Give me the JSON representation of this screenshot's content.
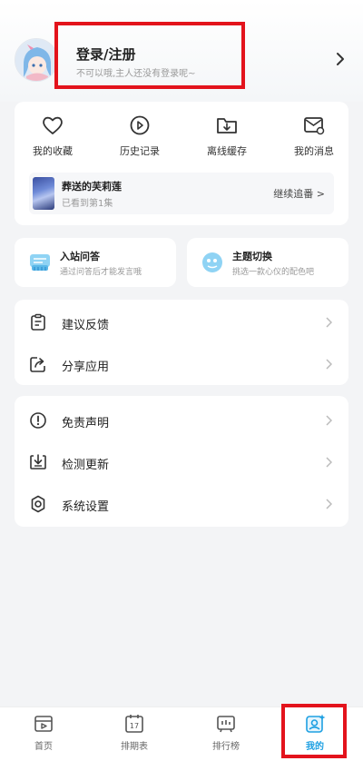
{
  "profile": {
    "login_label": "登录/注册",
    "login_sub": "不可以哦,主人还没有登录呢~"
  },
  "quick_actions": [
    {
      "label": "我的收藏",
      "icon": "heart-icon"
    },
    {
      "label": "历史记录",
      "icon": "history-icon"
    },
    {
      "label": "离线缓存",
      "icon": "folder-download-icon"
    },
    {
      "label": "我的消息",
      "icon": "message-icon"
    }
  ],
  "history": {
    "title": "葬送的芙莉莲",
    "episode": "已看到第1集",
    "continue_label": "继续追番 >"
  },
  "feature_cards": [
    {
      "title": "入站问答",
      "subtitle": "通过问答后才能发言哦",
      "icon": "quiz-icon"
    },
    {
      "title": "主题切换",
      "subtitle": "挑选一款心仪的配色吧",
      "icon": "theme-icon"
    }
  ],
  "menu_group_1": [
    {
      "label": "建议反馈",
      "icon": "feedback-icon"
    },
    {
      "label": "分享应用",
      "icon": "share-icon"
    }
  ],
  "menu_group_2": [
    {
      "label": "免责声明",
      "icon": "info-icon"
    },
    {
      "label": "检测更新",
      "icon": "update-icon"
    },
    {
      "label": "系统设置",
      "icon": "settings-icon"
    }
  ],
  "tabbar": [
    {
      "label": "首页",
      "icon": "home-icon"
    },
    {
      "label": "排期表",
      "icon": "calendar-icon"
    },
    {
      "label": "排行榜",
      "icon": "ranking-icon"
    },
    {
      "label": "我的",
      "icon": "profile-icon",
      "active": true
    }
  ],
  "colors": {
    "accent": "#1ea0e2",
    "highlight": "#e3131c",
    "background": "#f3f4f6"
  }
}
